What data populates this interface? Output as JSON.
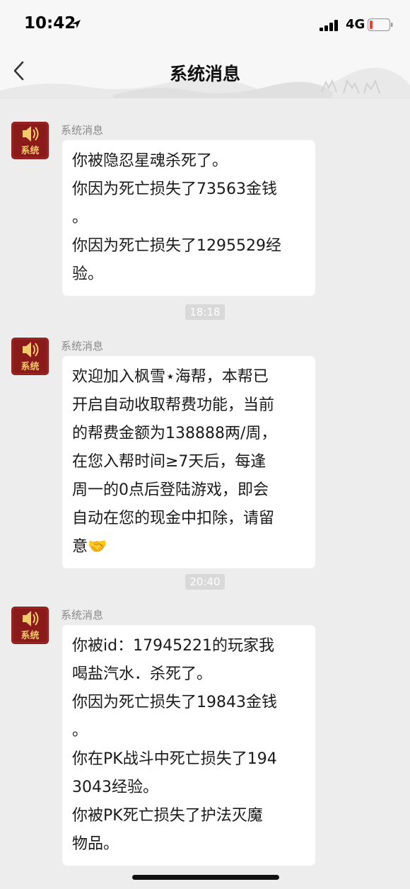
{
  "status_bar": {
    "time": "10:42",
    "network": "4G",
    "battery_color": "#ff3b30"
  },
  "nav": {
    "title": "系统消息",
    "back_icon": "chevron-left-icon"
  },
  "avatar_label": "系统",
  "messages": [
    {
      "sender": "系统消息",
      "text": "你被隐忍星魂杀死了。\n你因为死亡损失了73563金钱\n。\n你因为死亡损失了1295529经\n验。"
    },
    {
      "sender": "系统消息",
      "text": "欢迎加入枫雪⋆海帮，本帮已\n开启自动收取帮费功能，当前\n的帮费金额为138888两/周，\n在您入帮时间≥7天后，每逢\n周一的0点后登陆游戏，即会\n自动在您的现金中扣除，请留\n意🤝"
    },
    {
      "sender": "系统消息",
      "text": "你被id：17945221的玩家我\n喝盐汽水．杀死了。\n你因为死亡损失了19843金钱\n。\n你在PK战斗中死亡损失了194\n3043经验。\n你被PK死亡损失了护法灭魔\n物品。"
    }
  ],
  "time_separators": [
    "18:18",
    "20:40"
  ],
  "colors": {
    "background": "#ededed",
    "bubble": "#ffffff",
    "avatar_red": "#8b1a1a",
    "avatar_gold": "#f2c96b"
  }
}
